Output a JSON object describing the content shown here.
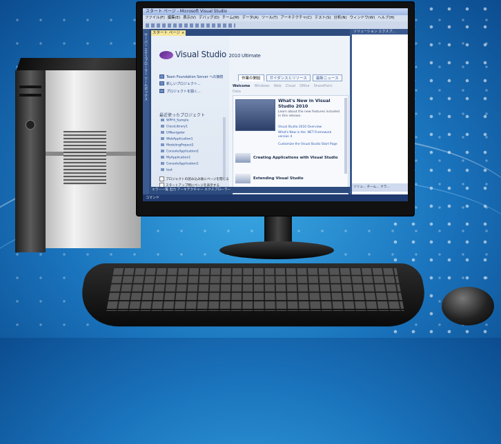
{
  "window": {
    "title": "スタート ページ - Microsoft Visual Studio"
  },
  "menu": [
    "ファイル(F)",
    "編集(E)",
    "表示(V)",
    "デバッグ(D)",
    "チーム(M)",
    "データ(A)",
    "ツール(T)",
    "アーキテクチャ(C)",
    "テスト(S)",
    "分析(N)",
    "ウィンドウ(W)",
    "ヘルプ(H)"
  ],
  "toolbox_label": "サーバー エクスプローラー  ツールボックス",
  "doc_tab": "スタート ページ ×",
  "logo": {
    "name": "Visual Studio",
    "edition": "2010 Ultimate"
  },
  "links": {
    "tfs": "Team Foundation Server への接続",
    "new_project": "新しいプロジェクト...",
    "open_project": "プロジェクトを開く..."
  },
  "recent": {
    "heading": "最近使ったプロジェクト",
    "items": [
      "WPF4_Sample",
      "ClassLibrary1",
      "UINavigator",
      "WebApplication1",
      "ModelingProject2",
      "ConsoleApplication2",
      "MyApplication1",
      "ConsoleApplication1",
      "test"
    ]
  },
  "options": {
    "close_after_load": "プロジェクトの読み込み後にページを閉じる",
    "show_on_startup": "スタートアップ時にページを表示する"
  },
  "tabs": [
    "作業の開始",
    "ガイダンスとリソース",
    "最新ニュース"
  ],
  "subtabs": [
    "Welcome",
    "Windows",
    "Web",
    "Cloud",
    "Office",
    "SharePoint"
  ],
  "subtab_extra": "Data",
  "news": {
    "heading": "What's New in Visual Studio 2010",
    "body": "Learn about the new features included in this release.",
    "links": [
      "Visual Studio 2010 Overview",
      "What's New in the .NET Framework version 4",
      "Customize the Visual Studio Start Page"
    ]
  },
  "sections": [
    "Creating Applications with Visual Studio",
    "Extending Visual Studio"
  ],
  "right_panel": {
    "title": "ソリューション エクスプ...",
    "bottom": "ソリュ...  チーム...  クラ..."
  },
  "bottom_tabs": "エラー一覧  出力  アーキテクチャー エクスプローラー",
  "status": "コマンド"
}
